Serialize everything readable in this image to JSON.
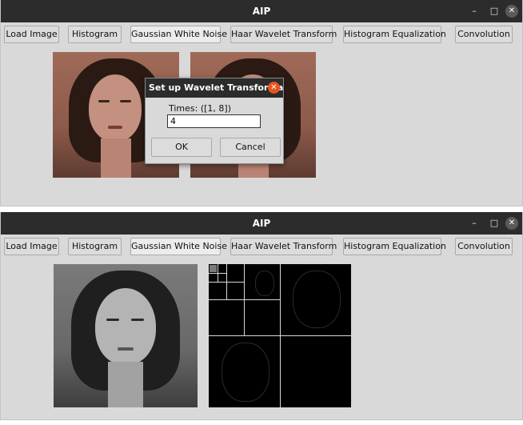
{
  "window_top": {
    "title": "AIP",
    "controls": {
      "minimize": "–",
      "maximize": "□",
      "close": "✕"
    },
    "toolbar": [
      "Load Image",
      "Histogram",
      "Gaussian White Noise",
      "Haar Wavelet Transform",
      "Histogram Equalization",
      "Convolution"
    ],
    "dialog": {
      "title": "Set up Wavelet Transforma...",
      "close": "✕",
      "label": "Times: ([1, 8])",
      "input_value": "4",
      "ok": "OK",
      "cancel": "Cancel"
    }
  },
  "window_bottom": {
    "title": "AIP",
    "controls": {
      "minimize": "–",
      "maximize": "□",
      "close": "✕"
    },
    "toolbar": [
      "Load Image",
      "Histogram",
      "Gaussian White Noise",
      "Haar Wavelet Transform",
      "Histogram Equalization",
      "Convolution"
    ]
  },
  "colors": {
    "titlebar": "#2c2c2c",
    "window_bg": "#d9d9d9",
    "dialog_close": "#e95420"
  }
}
